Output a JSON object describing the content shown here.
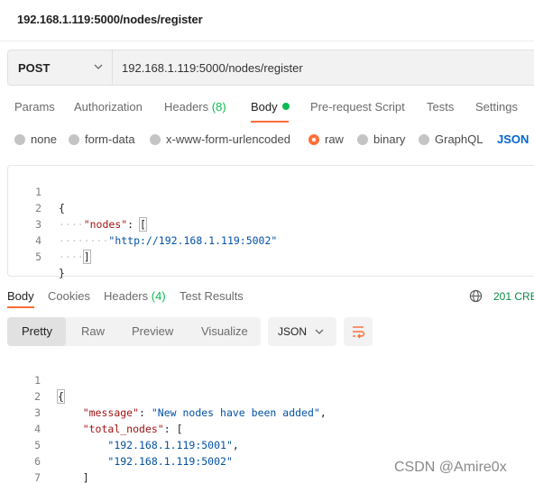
{
  "page": {
    "title": "192.168.1.119:5000/nodes/register"
  },
  "request": {
    "method": "POST",
    "url": "192.168.1.119:5000/nodes/register"
  },
  "request_tabs": {
    "params": "Params",
    "authorization": "Authorization",
    "headers": "Headers",
    "headers_count": "(8)",
    "body": "Body",
    "prerequest": "Pre-request Script",
    "tests": "Tests",
    "settings": "Settings"
  },
  "body_types": {
    "none": "none",
    "form_data": "form-data",
    "urlencoded": "x-www-form-urlencoded",
    "raw": "raw",
    "binary": "binary",
    "graphql": "GraphQL",
    "format": "JSON",
    "selected": "raw"
  },
  "request_body": {
    "lines": [
      {
        "n": "1",
        "t": "{"
      },
      {
        "n": "2",
        "t": "    \"nodes\": ["
      },
      {
        "n": "3",
        "t": "        \"http://192.168.1.119:5002\""
      },
      {
        "n": "4",
        "t": "    ]"
      },
      {
        "n": "5",
        "t": "}"
      }
    ]
  },
  "response_tabs": {
    "body": "Body",
    "cookies": "Cookies",
    "headers": "Headers",
    "headers_count": "(4)",
    "test_results": "Test Results",
    "status": "201 CRE"
  },
  "view_toolbar": {
    "pretty": "Pretty",
    "raw": "Raw",
    "preview": "Preview",
    "visualize": "Visualize",
    "format": "JSON"
  },
  "response_body": {
    "lines": [
      {
        "n": "1",
        "t": "{"
      },
      {
        "n": "2",
        "t": "    \"message\": \"New nodes have been added\","
      },
      {
        "n": "3",
        "t": "    \"total_nodes\": ["
      },
      {
        "n": "4",
        "t": "        \"192.168.1.119:5001\","
      },
      {
        "n": "5",
        "t": "        \"192.168.1.119:5002\""
      },
      {
        "n": "6",
        "t": "    ]"
      },
      {
        "n": "7",
        "t": "}"
      }
    ]
  },
  "watermark": "CSDN @Amire0x",
  "colors": {
    "accent": "#ff6c37",
    "success": "#0cbb52",
    "link": "#0265d2",
    "json_key": "#a31515",
    "json_string": "#0451a5"
  }
}
